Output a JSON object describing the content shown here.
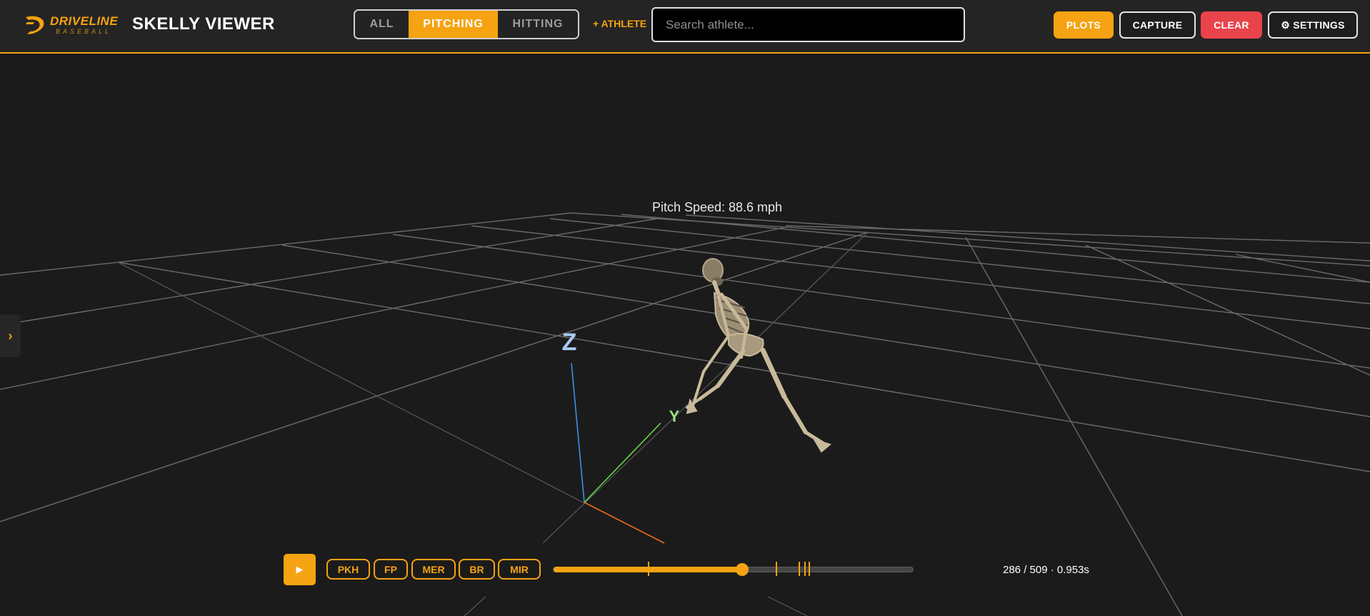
{
  "brand": {
    "line1": "DRIVELINE",
    "line2": "BASEBALL",
    "accent": "#f5a312"
  },
  "header": {
    "title": "SKELLY VIEWER",
    "filters": [
      {
        "label": "ALL",
        "active": false
      },
      {
        "label": "PITCHING",
        "active": true
      },
      {
        "label": "HITTING",
        "active": false
      }
    ],
    "add_athlete": "+ ATHLETE",
    "search_placeholder": "Search athlete...",
    "buttons": {
      "plots": "PLOTS",
      "capture": "CAPTURE",
      "clear": "CLEAR",
      "settings": "⚙ SETTINGS"
    }
  },
  "viewer": {
    "sidebar_toggle": "›",
    "pitch_speed": "Pitch Speed: 88.6 mph",
    "axes": {
      "z": "Z",
      "y": "Y"
    },
    "colors": {
      "z_axis": "#3f8ee8",
      "y_axis": "#67d84a",
      "x_axis": "#f06a1d",
      "grid": "#8a8a8a",
      "bone": "#c8b99a"
    }
  },
  "playback": {
    "play_icon": "▶",
    "events": [
      "PKH",
      "FP",
      "MER",
      "BR",
      "MIR"
    ],
    "current_frame": 286,
    "total_frames": 509,
    "readout": "286 / 509 · 0.953s",
    "event_frames": [
      143,
      337,
      372,
      380,
      387
    ]
  }
}
